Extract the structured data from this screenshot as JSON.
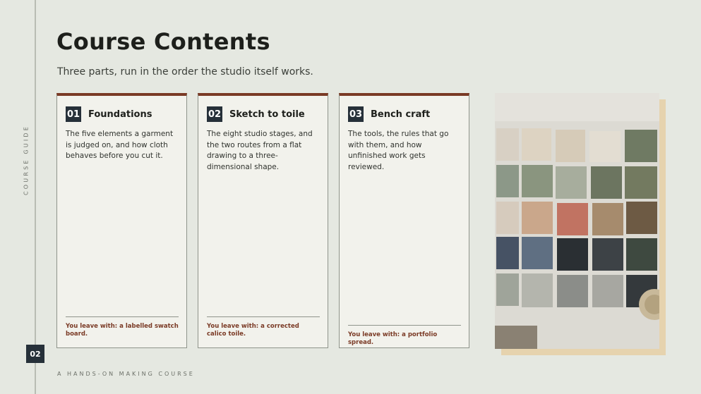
{
  "rail": {
    "label": "COURSE GUIDE",
    "page_number": "02"
  },
  "header": {
    "title": "Course Contents",
    "subtitle": "Three parts, run in the order the studio itself works."
  },
  "cards": [
    {
      "number": "01",
      "title": "Foundations",
      "body": "The five elements a garment is judged on, and how cloth behaves before you cut it.",
      "takeaway": "You leave with: a labelled swatch board."
    },
    {
      "number": "02",
      "title": "Sketch to toile",
      "body": "The eight studio stages, and the two routes from a flat drawing to a three-dimensional shape.",
      "takeaway": "You leave with: a corrected calico toile."
    },
    {
      "number": "03",
      "title": "Bench craft",
      "body": "The tools, the rules that go with them, and how unfinished work gets reviewed.",
      "takeaway": "You leave with: a portfolio spread."
    }
  ],
  "footer": {
    "text": "A HANDS-ON MAKING COURSE"
  },
  "colors": {
    "accent": "#7a3a25",
    "navy": "#263039",
    "background": "#e5e8e1",
    "photo_frame": "#e6d3ae"
  }
}
